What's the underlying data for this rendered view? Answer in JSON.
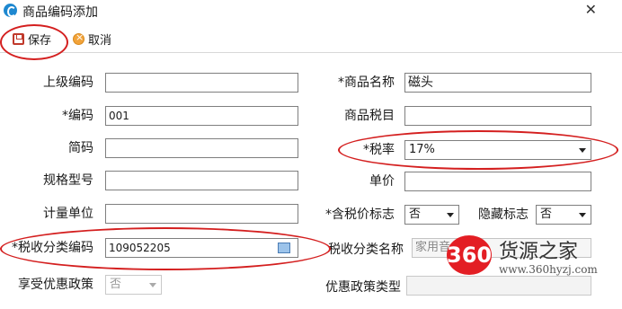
{
  "window": {
    "title": "商品编码添加"
  },
  "toolbar": {
    "save_label": "保存",
    "cancel_label": "取消"
  },
  "form": {
    "parent_code": {
      "label": "上级编码",
      "value": ""
    },
    "code": {
      "label": "*编码",
      "value": "001"
    },
    "short_code": {
      "label": "简码",
      "value": ""
    },
    "spec_model": {
      "label": "规格型号",
      "value": ""
    },
    "unit": {
      "label": "计量单位",
      "value": ""
    },
    "tax_class_code": {
      "label": "*税收分类编码",
      "value": "109052205"
    },
    "preferential_policy": {
      "label": "享受优惠政策",
      "value": "否"
    },
    "product_name": {
      "label": "*商品名称",
      "value": "磁头"
    },
    "tax_item": {
      "label": "商品税目",
      "value": ""
    },
    "tax_rate": {
      "label": "*税率",
      "value": "17%"
    },
    "unit_price": {
      "label": "单价",
      "value": ""
    },
    "tax_included_flag": {
      "label": "*含税价标志",
      "value": "否"
    },
    "hidden_flag": {
      "label": "隐藏标志",
      "value": "否"
    },
    "tax_class_name": {
      "label": "税收分类名称",
      "value": "家用音"
    },
    "preferential_policy_type": {
      "label": "优惠政策类型",
      "value": ""
    }
  },
  "watermark": {
    "badge": "360",
    "text": "货源之家",
    "url": "www.360hyzj.com"
  },
  "colors": {
    "annotation": "#d41f1f",
    "watermark_red": "#e31e24"
  }
}
